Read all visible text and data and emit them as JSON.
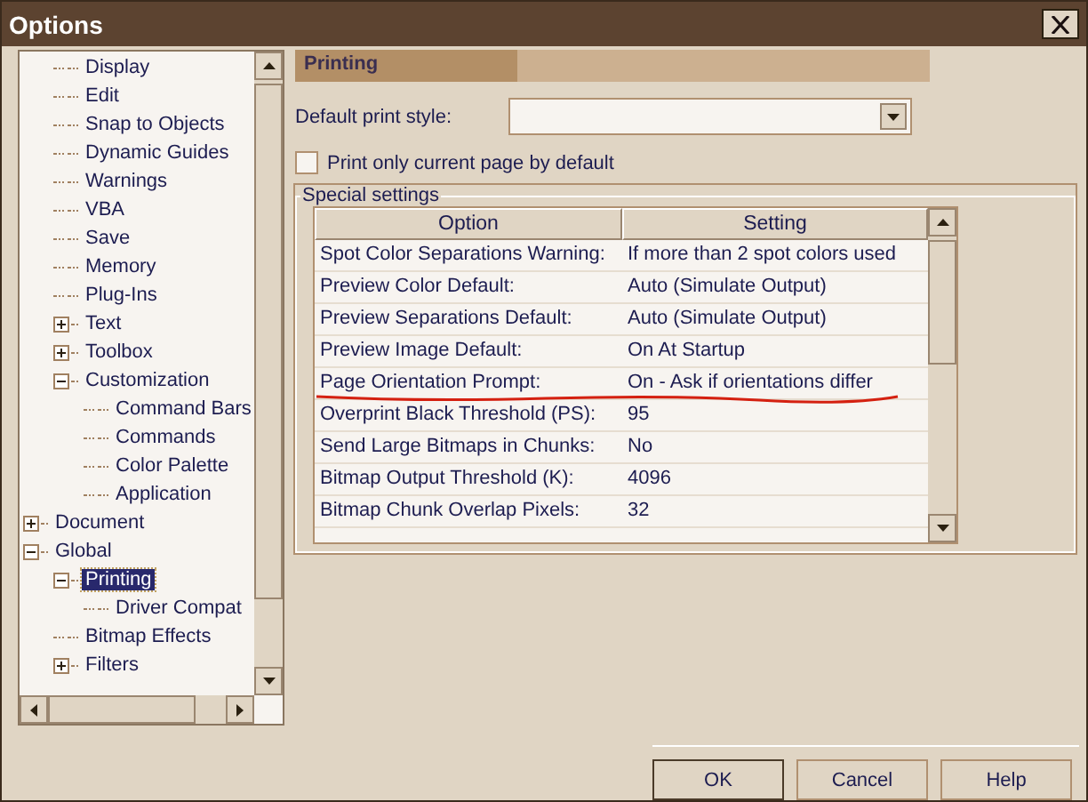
{
  "window": {
    "title": "Options"
  },
  "tree": {
    "items": [
      {
        "children": [
          {
            "label": "Display",
            "selected": false
          },
          {
            "label": "Edit",
            "selected": false
          },
          {
            "label": "Snap to Objects",
            "selected": false
          },
          {
            "label": "Dynamic Guides",
            "selected": false
          },
          {
            "label": "Warnings",
            "selected": false
          },
          {
            "label": "VBA",
            "selected": false
          },
          {
            "label": "Save",
            "selected": false
          },
          {
            "label": "Memory",
            "selected": false
          },
          {
            "label": "Plug-Ins",
            "selected": false
          },
          {
            "label": "Text",
            "selected": false,
            "expanded": false
          },
          {
            "label": "Toolbox",
            "selected": false,
            "expanded": false
          },
          {
            "label": "Customization",
            "selected": false,
            "expanded": true,
            "children": [
              {
                "label": "Command Bars",
                "selected": false
              },
              {
                "label": "Commands",
                "selected": false
              },
              {
                "label": "Color Palette",
                "selected": false
              },
              {
                "label": "Application",
                "selected": false
              }
            ]
          }
        ]
      },
      {
        "label": "Document",
        "selected": false,
        "expanded": false
      },
      {
        "label": "Global",
        "selected": false,
        "expanded": true,
        "children": [
          {
            "label": "Printing",
            "selected": true,
            "expanded": true,
            "children": [
              {
                "label": "Driver Compat",
                "selected": false
              }
            ]
          },
          {
            "label": "Bitmap Effects",
            "selected": false
          },
          {
            "label": "Filters",
            "selected": false,
            "expanded": false
          }
        ]
      }
    ]
  },
  "page_header": "Printing",
  "default_print_style": {
    "label": "Default print style:"
  },
  "print_current_page": {
    "label": "Print only current page by default",
    "checked": false
  },
  "special_settings": {
    "title": "Special settings",
    "columns": [
      "Option",
      "Setting"
    ],
    "rows": [
      {
        "option": "Spot Color Separations Warning:",
        "setting": "If more than 2 spot colors used"
      },
      {
        "option": "Preview Color Default:",
        "setting": "Auto (Simulate Output)"
      },
      {
        "option": "Preview Separations Default:",
        "setting": "Auto (Simulate Output)"
      },
      {
        "option": "Preview Image Default:",
        "setting": "On At Startup"
      },
      {
        "option": "Page Orientation Prompt:",
        "setting": "On - Ask if orientations differ",
        "underlined": true
      },
      {
        "option": "Overprint Black Threshold (PS):",
        "setting": "95"
      },
      {
        "option": "Send Large Bitmaps in Chunks:",
        "setting": "No"
      },
      {
        "option": "Bitmap Output Threshold (K):",
        "setting": "4096"
      },
      {
        "option": "Bitmap Chunk Overlap Pixels:",
        "setting": "32"
      }
    ]
  },
  "buttons": [
    {
      "label": "OK",
      "default": true
    },
    {
      "label": "Cancel",
      "default": false
    },
    {
      "label": "Help",
      "default": false
    }
  ]
}
